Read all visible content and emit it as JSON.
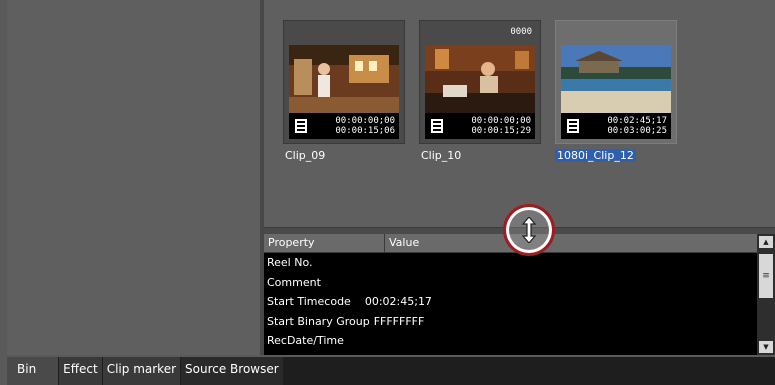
{
  "clips": [
    {
      "name": "Clip_09",
      "number": "",
      "tc_in": "00:00:00;00",
      "tc_out": "00:00:15;06",
      "selected": false
    },
    {
      "name": "Clip_10",
      "number": "0000",
      "tc_in": "00:00:00;00",
      "tc_out": "00:00:15;29",
      "selected": false
    },
    {
      "name": "1080i_Clip_12",
      "number": "",
      "tc_in": "00:02:45;17",
      "tc_out": "00:03:00;25",
      "selected": true
    }
  ],
  "properties": {
    "header": {
      "property": "Property",
      "value": "Value"
    },
    "rows": [
      {
        "key": "Reel No.",
        "value": ""
      },
      {
        "key": "Comment",
        "value": ""
      },
      {
        "key": "Start Timecode",
        "value": "00:02:45;17"
      },
      {
        "key": "Start Binary Group",
        "value": "FFFFFFFF"
      },
      {
        "key": "RecDate/Time",
        "value": ""
      }
    ]
  },
  "tabs": [
    "Bin",
    "Effect",
    "Clip marker",
    "Source Browser"
  ],
  "icons": {
    "film": "film-clip-icon",
    "resize": "vertical-resize-cursor-icon",
    "up": "scroll-up-arrow-icon",
    "down": "scroll-down-arrow-icon",
    "grip": "scroll-grip-icon"
  },
  "colors": {
    "selection": "#2f5fb0",
    "cursor_ring": "#9e1c22"
  }
}
